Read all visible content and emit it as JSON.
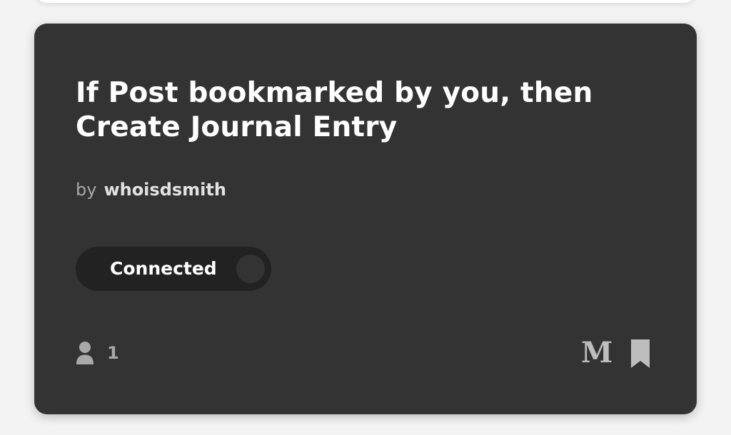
{
  "applet": {
    "title": "If Post bookmarked by you, then Create Journal Entry",
    "by_prefix": "by",
    "author": "whoisdsmith",
    "toggle_label": "Connected",
    "user_count": "1",
    "service_letter": "M"
  },
  "colors": {
    "card_background": "#333333",
    "toggle_background": "#222222",
    "page_background": "#f3f3f3",
    "muted_text": "#a9a9a9"
  },
  "icons": {
    "user": "user-icon",
    "service": "medium-logo-icon",
    "bookmark": "bookmark-icon"
  }
}
